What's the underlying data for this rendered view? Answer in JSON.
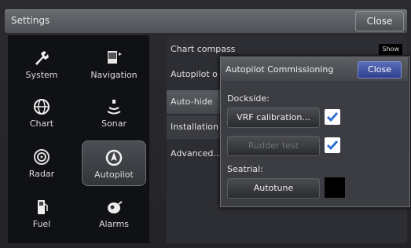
{
  "header": {
    "title": "Settings",
    "close_label": "Close"
  },
  "categories": [
    {
      "label": "System",
      "icon": "wrench-icon"
    },
    {
      "label": "Navigation",
      "icon": "navigation-icon"
    },
    {
      "label": "Chart",
      "icon": "globe-icon"
    },
    {
      "label": "Sonar",
      "icon": "sonar-icon"
    },
    {
      "label": "Radar",
      "icon": "radar-icon"
    },
    {
      "label": "Autopilot",
      "icon": "autopilot-icon",
      "selected": true
    },
    {
      "label": "Fuel",
      "icon": "fuel-pump-icon"
    },
    {
      "label": "Alarms",
      "icon": "alarm-icon"
    }
  ],
  "settings_list": {
    "items": [
      "Chart compass",
      "Autopilot o",
      "Auto-hide",
      "Installation",
      "Advanced..."
    ],
    "chart_compass_value": "Show"
  },
  "dialog": {
    "title": "Autopilot Commissioning",
    "close_label": "Close",
    "dockside_label": "Dockside:",
    "vrf_button": "VRF calibration...",
    "rudder_button": "Rudder test",
    "seatrial_label": "Seatrial:",
    "autotune_button": "Autotune"
  },
  "colors": {
    "accent_blue": "#2f3f8a",
    "check_blue": "#2f6fd1"
  }
}
